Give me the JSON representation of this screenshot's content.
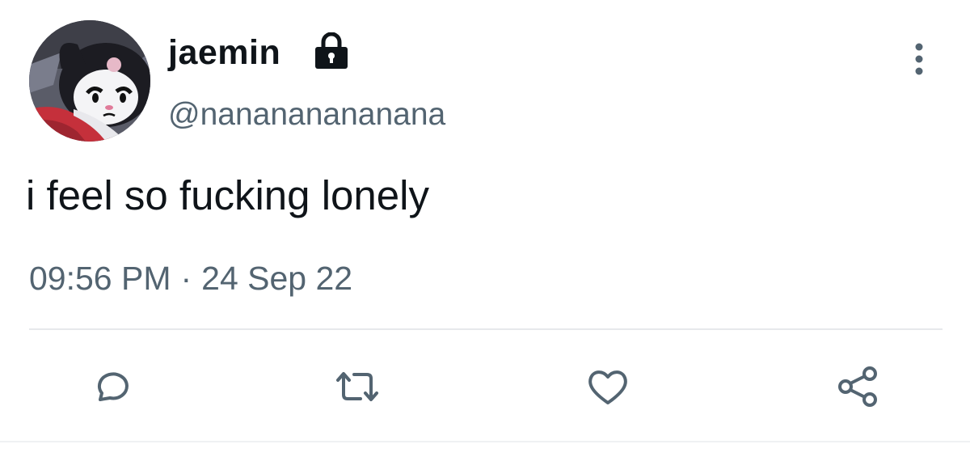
{
  "user": {
    "display_name": "jaemin",
    "handle": "@nanananananana",
    "avatar_icon": "kuromi-avatar",
    "protected_icon": "lock-icon"
  },
  "tweet": {
    "text": "i feel so fucking lonely",
    "time": "09:56 PM",
    "separator": "·",
    "date": "24 Sep 22"
  },
  "actions": [
    {
      "name": "reply",
      "icon": "comment-icon"
    },
    {
      "name": "retweet",
      "icon": "retweet-icon"
    },
    {
      "name": "like",
      "icon": "heart-icon"
    },
    {
      "name": "share",
      "icon": "share-icon"
    }
  ],
  "menu": {
    "icon": "vertical-ellipsis-icon"
  },
  "colors": {
    "text": "#0f1419",
    "secondary": "#536471",
    "divider": "#e7e9ec"
  }
}
